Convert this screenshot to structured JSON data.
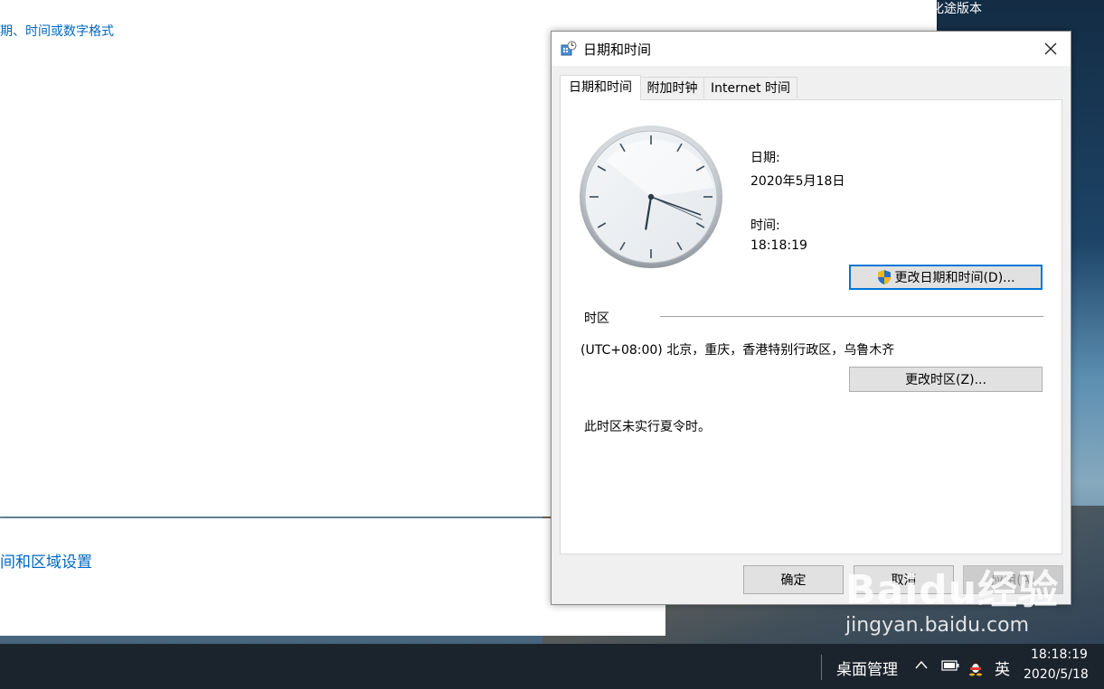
{
  "desktop": {
    "top_right_text": "化途版本"
  },
  "background_window": {
    "top_link": "期、时间或数字格式",
    "bottom_link": "间和区域设置"
  },
  "dialog": {
    "title": "日期和时间",
    "tabs": [
      {
        "label": "日期和时间",
        "active": true
      },
      {
        "label": "附加时钟",
        "active": false
      },
      {
        "label": "Internet 时间",
        "active": false
      }
    ],
    "date_label": "日期:",
    "date_value": "2020年5月18日",
    "time_label": "时间:",
    "time_value": "18:18:19",
    "change_datetime_button": "更改日期和时间(D)...",
    "timezone_section_label": "时区",
    "timezone_value": "(UTC+08:00) 北京，重庆，香港特别行政区，乌鲁木齐",
    "change_timezone_button": "更改时区(Z)...",
    "dst_note": "此时区未实行夏令时。",
    "ok_button": "确定",
    "cancel_button": "取消",
    "apply_button": "应用(A)",
    "clock": {
      "hours": 18,
      "minutes": 18,
      "seconds": 19
    }
  },
  "taskbar": {
    "desktop_manager": "桌面管理",
    "ime_indicator": "英",
    "time": "18:18:19",
    "date": "2020/5/18"
  },
  "watermark": {
    "brand": "Baidu经验",
    "url": "jingyan.baidu.com"
  },
  "colors": {
    "link_blue": "#0067c0",
    "focus_blue": "#0078d7",
    "taskbar": "#1b242d"
  }
}
